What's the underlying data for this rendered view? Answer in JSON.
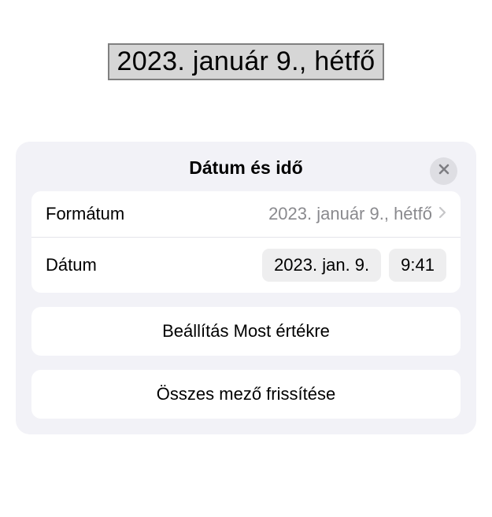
{
  "display": {
    "selected_date": "2023. január 9., hétfő"
  },
  "popup": {
    "title": "Dátum és idő",
    "format": {
      "label": "Formátum",
      "value": "2023. január 9., hétfő"
    },
    "date": {
      "label": "Dátum",
      "date_value": "2023. jan. 9.",
      "time_value": "9:41"
    },
    "actions": {
      "set_now": "Beállítás Most értékre",
      "update_all": "Összes mező frissítése"
    }
  }
}
